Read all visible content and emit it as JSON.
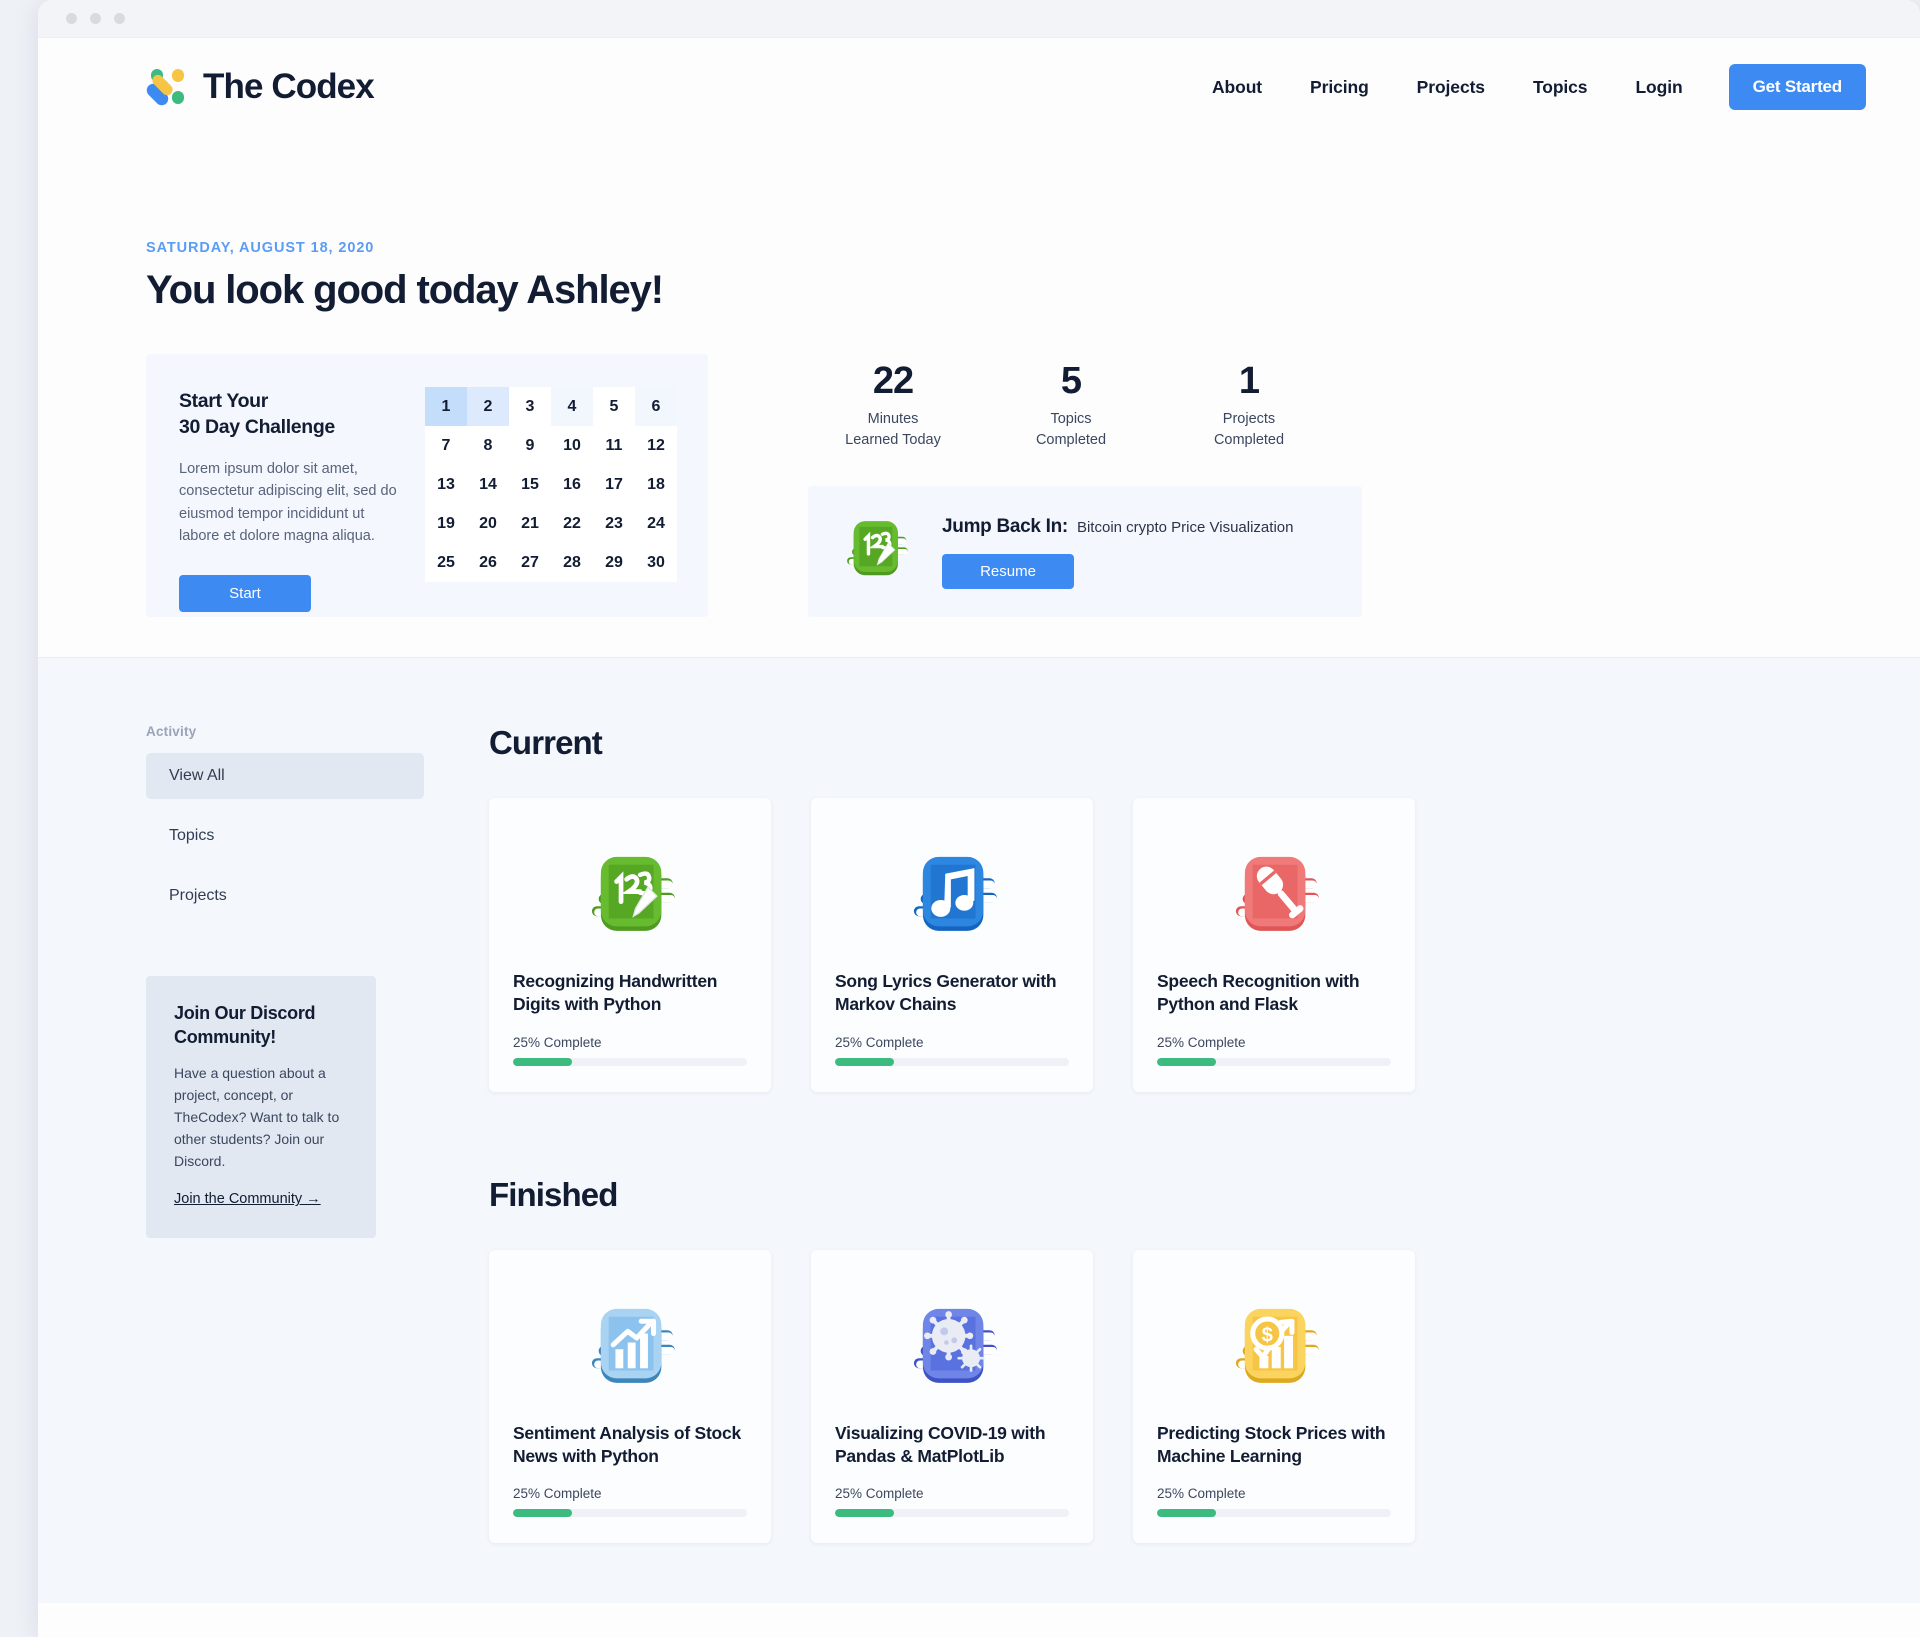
{
  "brand": {
    "name": "The Codex"
  },
  "nav": {
    "links": [
      "About",
      "Pricing",
      "Projects",
      "Topics",
      "Login"
    ],
    "cta": "Get Started"
  },
  "hero": {
    "date": "SATURDAY, AUGUST 18, 2020",
    "greeting": "You look good today Ashley!"
  },
  "challenge": {
    "title_line1": "Start Your",
    "title_line2": "30 Day Challenge",
    "description": "Lorem ipsum dolor sit amet, consectetur adipiscing elit, sed do eiusmod tempor incididunt ut labore et dolore magna aliqua.",
    "button": "Start",
    "calendar": {
      "rows": [
        [
          {
            "day": "1",
            "level": 3
          },
          {
            "day": "2",
            "level": 2
          },
          {
            "day": "3",
            "level": 0
          },
          {
            "day": "4",
            "level": 1
          },
          {
            "day": "5",
            "level": 0
          },
          {
            "day": "6",
            "level": 1
          }
        ],
        [
          {
            "day": "7",
            "level": 0
          },
          {
            "day": "8",
            "level": 0
          },
          {
            "day": "9",
            "level": 0
          },
          {
            "day": "10",
            "level": 0
          },
          {
            "day": "11",
            "level": 0
          },
          {
            "day": "12",
            "level": 0
          }
        ],
        [
          {
            "day": "13",
            "level": 0
          },
          {
            "day": "14",
            "level": 0
          },
          {
            "day": "15",
            "level": 0
          },
          {
            "day": "16",
            "level": 0
          },
          {
            "day": "17",
            "level": 0
          },
          {
            "day": "18",
            "level": 0
          }
        ],
        [
          {
            "day": "19",
            "level": 0
          },
          {
            "day": "20",
            "level": 0
          },
          {
            "day": "21",
            "level": 0
          },
          {
            "day": "22",
            "level": 0
          },
          {
            "day": "23",
            "level": 0
          },
          {
            "day": "24",
            "level": 0
          }
        ],
        [
          {
            "day": "25",
            "level": 0
          },
          {
            "day": "26",
            "level": 0
          },
          {
            "day": "27",
            "level": 0
          },
          {
            "day": "28",
            "level": 0
          },
          {
            "day": "29",
            "level": 0
          },
          {
            "day": "30",
            "level": 0
          }
        ]
      ]
    }
  },
  "stats": [
    {
      "value": "22",
      "label_line1": "Minutes",
      "label_line2": "Learned Today"
    },
    {
      "value": "5",
      "label_line1": "Topics",
      "label_line2": "Completed"
    },
    {
      "value": "1",
      "label_line1": "Projects",
      "label_line2": "Completed"
    }
  ],
  "jump_back": {
    "label": "Jump Back In:",
    "project": "Bitcoin crypto Price Visualization",
    "button": "Resume",
    "icon": "notebook-123-icon"
  },
  "sidebar": {
    "heading": "Activity",
    "items": [
      "View All",
      "Topics",
      "Projects"
    ],
    "active_index": 0,
    "discord": {
      "title": "Join Our Discord Community!",
      "body": "Have a question about a project, concept, or TheCodex? Want to talk to other students? Join our Discord.",
      "link": "Join the Community →"
    }
  },
  "sections": [
    {
      "title": "Current",
      "cards": [
        {
          "title": "Recognizing Handwritten Digits with Python",
          "progress_label": "25% Complete",
          "progress": 25,
          "icon": "notebook-123-icon",
          "color": "#5cb53a"
        },
        {
          "title": "Song Lyrics Generator with Markov Chains",
          "progress_label": "25% Complete",
          "progress": 25,
          "icon": "notebook-music-icon",
          "color": "#2d86e0"
        },
        {
          "title": "Speech Recognition with Python and Flask",
          "progress_label": "25% Complete",
          "progress": 25,
          "icon": "notebook-microphone-icon",
          "color": "#f06a6a"
        }
      ]
    },
    {
      "title": "Finished",
      "cards": [
        {
          "title": "Sentiment Analysis of Stock News with Python",
          "progress_label": "25% Complete",
          "progress": 25,
          "icon": "notebook-chart-icon",
          "color": "#84bdeb"
        },
        {
          "title": "Visualizing COVID-19 with Pandas & MatPlotLib",
          "progress_label": "25% Complete",
          "progress": 25,
          "icon": "notebook-virus-icon",
          "color": "#5a72e0"
        },
        {
          "title": "Predicting Stock Prices with Machine Learning",
          "progress_label": "25% Complete",
          "progress": 25,
          "icon": "notebook-dollar-chart-icon",
          "color": "#f7c545"
        }
      ]
    }
  ],
  "colors": {
    "accent": "#3d8bf2",
    "dark": "#121c32",
    "progress": "#3cba7f",
    "body_bg": "#f4f7fc"
  }
}
